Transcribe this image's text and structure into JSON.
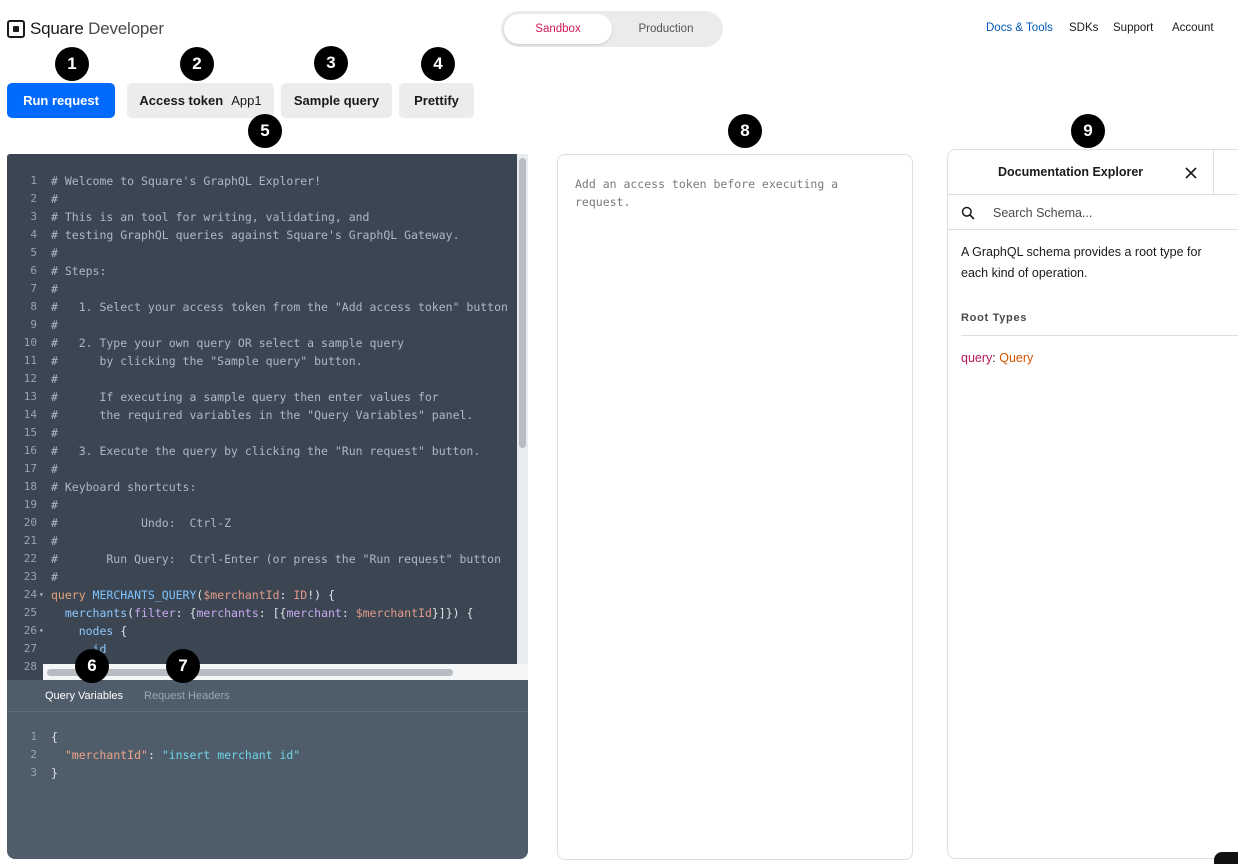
{
  "header": {
    "brand": {
      "strong": "Square",
      "light": " Developer"
    },
    "env": {
      "sandbox": "Sandbox",
      "production": "Production"
    },
    "nav": {
      "docs": "Docs & Tools",
      "sdks": "SDKs",
      "support": "Support",
      "account": "Account"
    }
  },
  "toolbar": {
    "run": "Run request",
    "token_label": "Access token",
    "token_value": "App1",
    "sample": "Sample query",
    "prettify": "Prettify"
  },
  "badges": [
    "1",
    "2",
    "3",
    "4",
    "5",
    "6",
    "7",
    "8",
    "9"
  ],
  "editor": {
    "lines": [
      {
        "n": "1",
        "t": "# Welcome to Square's GraphQL Explorer!"
      },
      {
        "n": "2",
        "t": "#"
      },
      {
        "n": "3",
        "t": "# This is an tool for writing, validating, and"
      },
      {
        "n": "4",
        "t": "# testing GraphQL queries against Square's GraphQL Gateway."
      },
      {
        "n": "5",
        "t": "#"
      },
      {
        "n": "6",
        "t": "# Steps:"
      },
      {
        "n": "7",
        "t": "#"
      },
      {
        "n": "8",
        "t": "#   1. Select your access token from the \"Add access token\" button"
      },
      {
        "n": "9",
        "t": "#"
      },
      {
        "n": "10",
        "t": "#   2. Type your own query OR select a sample query"
      },
      {
        "n": "11",
        "t": "#      by clicking the \"Sample query\" button."
      },
      {
        "n": "12",
        "t": "#"
      },
      {
        "n": "13",
        "t": "#      If executing a sample query then enter values for"
      },
      {
        "n": "14",
        "t": "#      the required variables in the \"Query Variables\" panel."
      },
      {
        "n": "15",
        "t": "#"
      },
      {
        "n": "16",
        "t": "#   3. Execute the query by clicking the \"Run request\" button."
      },
      {
        "n": "17",
        "t": "#"
      },
      {
        "n": "18",
        "t": "# Keyboard shortcuts:"
      },
      {
        "n": "19",
        "t": "#"
      },
      {
        "n": "20",
        "t": "#            Undo:  Ctrl-Z"
      },
      {
        "n": "21",
        "t": "#"
      },
      {
        "n": "22",
        "t": "#       Run Query:  Ctrl-Enter (or press the \"Run request\" button"
      },
      {
        "n": "23",
        "t": "#"
      }
    ],
    "code_lines": [
      {
        "n": "24",
        "fold": "▾",
        "parts": [
          {
            "t": "query",
            "c": "kw"
          },
          {
            "t": " MERCHANTS_QUERY",
            "c": "def"
          },
          {
            "t": "(",
            "c": "plain"
          },
          {
            "t": "$merchantId",
            "c": "var"
          },
          {
            "t": ": ",
            "c": "plain"
          },
          {
            "t": "ID",
            "c": "var"
          },
          {
            "t": "!) {",
            "c": "plain"
          }
        ]
      },
      {
        "n": "25",
        "fold": "",
        "parts": [
          {
            "t": "  merchants",
            "c": "fld"
          },
          {
            "t": "(",
            "c": "plain"
          },
          {
            "t": "filter",
            "c": "arg"
          },
          {
            "t": ": {",
            "c": "plain"
          },
          {
            "t": "merchants",
            "c": "arg"
          },
          {
            "t": ": [{",
            "c": "plain"
          },
          {
            "t": "merchant",
            "c": "arg"
          },
          {
            "t": ": ",
            "c": "plain"
          },
          {
            "t": "$merchantId",
            "c": "var"
          },
          {
            "t": "}]}) {",
            "c": "plain"
          }
        ]
      },
      {
        "n": "26",
        "fold": "▾",
        "parts": [
          {
            "t": "    nodes",
            "c": "fld"
          },
          {
            "t": " {",
            "c": "plain"
          }
        ]
      },
      {
        "n": "27",
        "fold": "",
        "parts": [
          {
            "t": "      id",
            "c": "fld"
          }
        ]
      },
      {
        "n": "28",
        "fold": "",
        "parts": [
          {
            "t": "",
            "c": "plain"
          }
        ]
      }
    ]
  },
  "variables": {
    "tabs": {
      "query_variables": "Query Variables",
      "request_headers": "Request Headers"
    },
    "lines": [
      {
        "n": "1",
        "parts": [
          {
            "t": "{",
            "c": "plain"
          }
        ]
      },
      {
        "n": "2",
        "parts": [
          {
            "t": "  ",
            "c": "plain"
          },
          {
            "t": "\"merchantId\"",
            "c": "json-key"
          },
          {
            "t": ": ",
            "c": "plain"
          },
          {
            "t": "\"insert merchant id\"",
            "c": "json-str"
          }
        ]
      },
      {
        "n": "3",
        "parts": [
          {
            "t": "}",
            "c": "plain"
          }
        ]
      }
    ]
  },
  "result": {
    "message": "Add an access token before executing a request."
  },
  "docs": {
    "title": "Documentation Explorer",
    "search_placeholder": "Search Schema...",
    "description": "A GraphQL schema provides a root type for each kind of operation.",
    "root_types_heading": "Root Types",
    "root_query_name": "query",
    "root_query_type": "Query"
  },
  "colors": {
    "primary_button": "#006aff",
    "sandbox_accent": "#d1195b",
    "docs_link": "#0057b8",
    "editor_bg": "#3b4652",
    "variables_bg": "#4f5c6a"
  }
}
